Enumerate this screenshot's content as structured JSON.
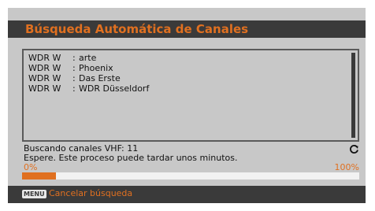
{
  "title": "Búsqueda Automática de Canales",
  "channels": [
    {
      "source": "WDR W",
      "separator": ":",
      "name": "arte"
    },
    {
      "source": "WDR W",
      "separator": ":",
      "name": "Phoenix"
    },
    {
      "source": "WDR W",
      "separator": ":",
      "name": "Das Erste"
    },
    {
      "source": "WDR W",
      "separator": ":",
      "name": "WDR Düsseldorf"
    }
  ],
  "status": {
    "scanning": "Buscando canales VHF: 11",
    "wait_message": "Espere. Este proceso puede tardar unos minutos."
  },
  "progress": {
    "min_label": "0%",
    "max_label": "100%",
    "value": 0.1
  },
  "footer": {
    "key_label": "MENU",
    "action_label": "Cancelar búsqueda"
  },
  "colors": {
    "accent": "#e07020",
    "panel": "#c8c8c8",
    "bar": "#3a3a3a"
  },
  "icons": {
    "refresh": "refresh-icon"
  }
}
